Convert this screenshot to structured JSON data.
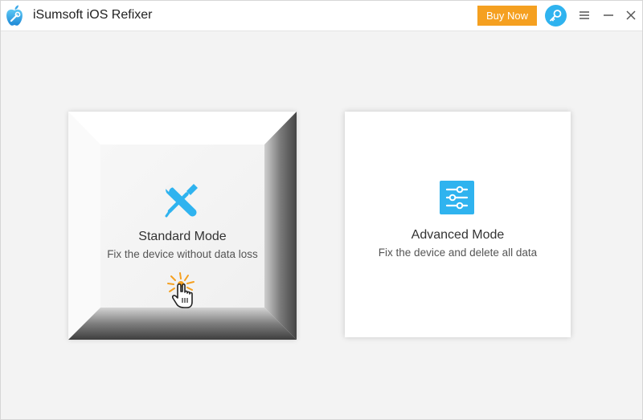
{
  "app": {
    "title": "iSumsoft iOS Refixer",
    "buy_label": "Buy Now",
    "icons": {
      "logo": "apple-wrench-logo-icon",
      "register": "key-icon",
      "menu": "menu-icon",
      "minimize": "minimize-icon",
      "close": "close-icon"
    },
    "colors": {
      "accent": "#2fb3ef",
      "buy": "#f5a020",
      "background": "#f3f3f3"
    }
  },
  "modes": [
    {
      "title": "Standard Mode",
      "description": "Fix the device without data loss",
      "icon": "tools-icon",
      "state": "pressed"
    },
    {
      "title": "Advanced Mode",
      "description": "Fix the device and delete all data",
      "icon": "sliders-icon",
      "state": "normal"
    }
  ]
}
